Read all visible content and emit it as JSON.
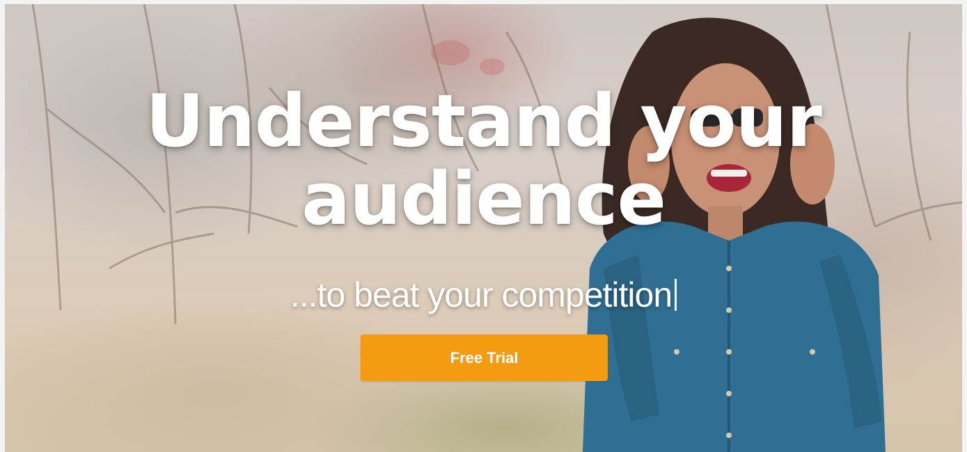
{
  "hero": {
    "headline_line1": "Understand your",
    "headline_line2": "audience",
    "tagline": "...to beat your competition",
    "cta_label": "Free Trial"
  },
  "colors": {
    "cta_background": "#f39c12",
    "headline_text": "#ffffff"
  }
}
